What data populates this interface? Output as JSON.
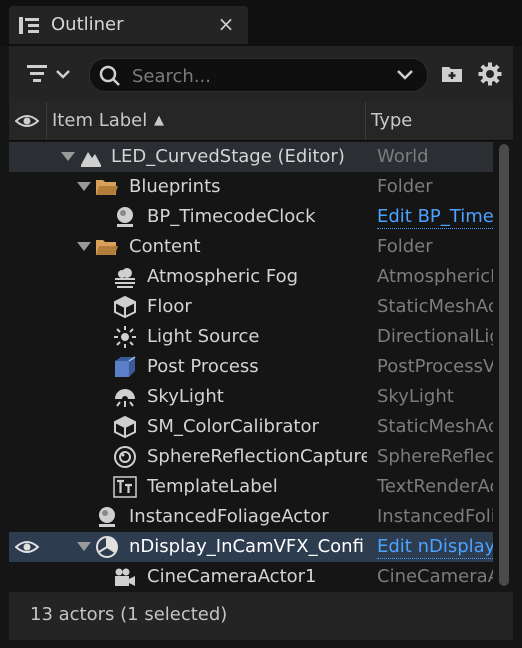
{
  "tab": {
    "title": "Outliner",
    "close": "×"
  },
  "search": {
    "placeholder": "Search..."
  },
  "columns": {
    "item_label": "Item Label",
    "sort_indicator": "▲",
    "type": "Type"
  },
  "rows": [
    {
      "label": "LED_CurvedStage (Editor)",
      "type": "World",
      "icon": "level-icon"
    },
    {
      "label": "Blueprints",
      "type": "Folder",
      "icon": "folder-icon"
    },
    {
      "label": "BP_TimecodeClock",
      "type": "Edit BP_TimecodeClock",
      "icon": "actor-icon"
    },
    {
      "label": "Content",
      "type": "Folder",
      "icon": "folder-icon"
    },
    {
      "label": "Atmospheric Fog",
      "type": "AtmosphericFog",
      "icon": "fog-icon"
    },
    {
      "label": "Floor",
      "type": "StaticMeshActor",
      "icon": "static-mesh-icon"
    },
    {
      "label": "Light Source",
      "type": "DirectionalLight",
      "icon": "directional-light-icon"
    },
    {
      "label": "Post Process",
      "type": "PostProcessVolume",
      "icon": "post-process-icon"
    },
    {
      "label": "SkyLight",
      "type": "SkyLight",
      "icon": "skylight-icon"
    },
    {
      "label": "SM_ColorCalibrator",
      "type": "StaticMeshActor",
      "icon": "static-mesh-icon"
    },
    {
      "label": "SphereReflectionCapture",
      "type": "SphereReflectionCapture",
      "icon": "reflection-capture-icon"
    },
    {
      "label": "TemplateLabel",
      "type": "TextRenderActor",
      "icon": "text-render-icon"
    },
    {
      "label": "InstancedFoliageActor",
      "type": "InstancedFoliageActor",
      "icon": "actor-icon"
    },
    {
      "label": "nDisplay_InCamVFX_Config",
      "type": "Edit nDisplay_InCamVFX_Config",
      "icon": "ndisplay-icon"
    },
    {
      "label": "CineCameraActor1",
      "type": "CineCameraActor",
      "icon": "camera-icon"
    }
  ],
  "footer": {
    "status": "13 actors (1 selected)"
  },
  "colors": {
    "selected_row": "#2e3c50",
    "world_row": "#2b2e33",
    "link": "#4ba3ff"
  }
}
